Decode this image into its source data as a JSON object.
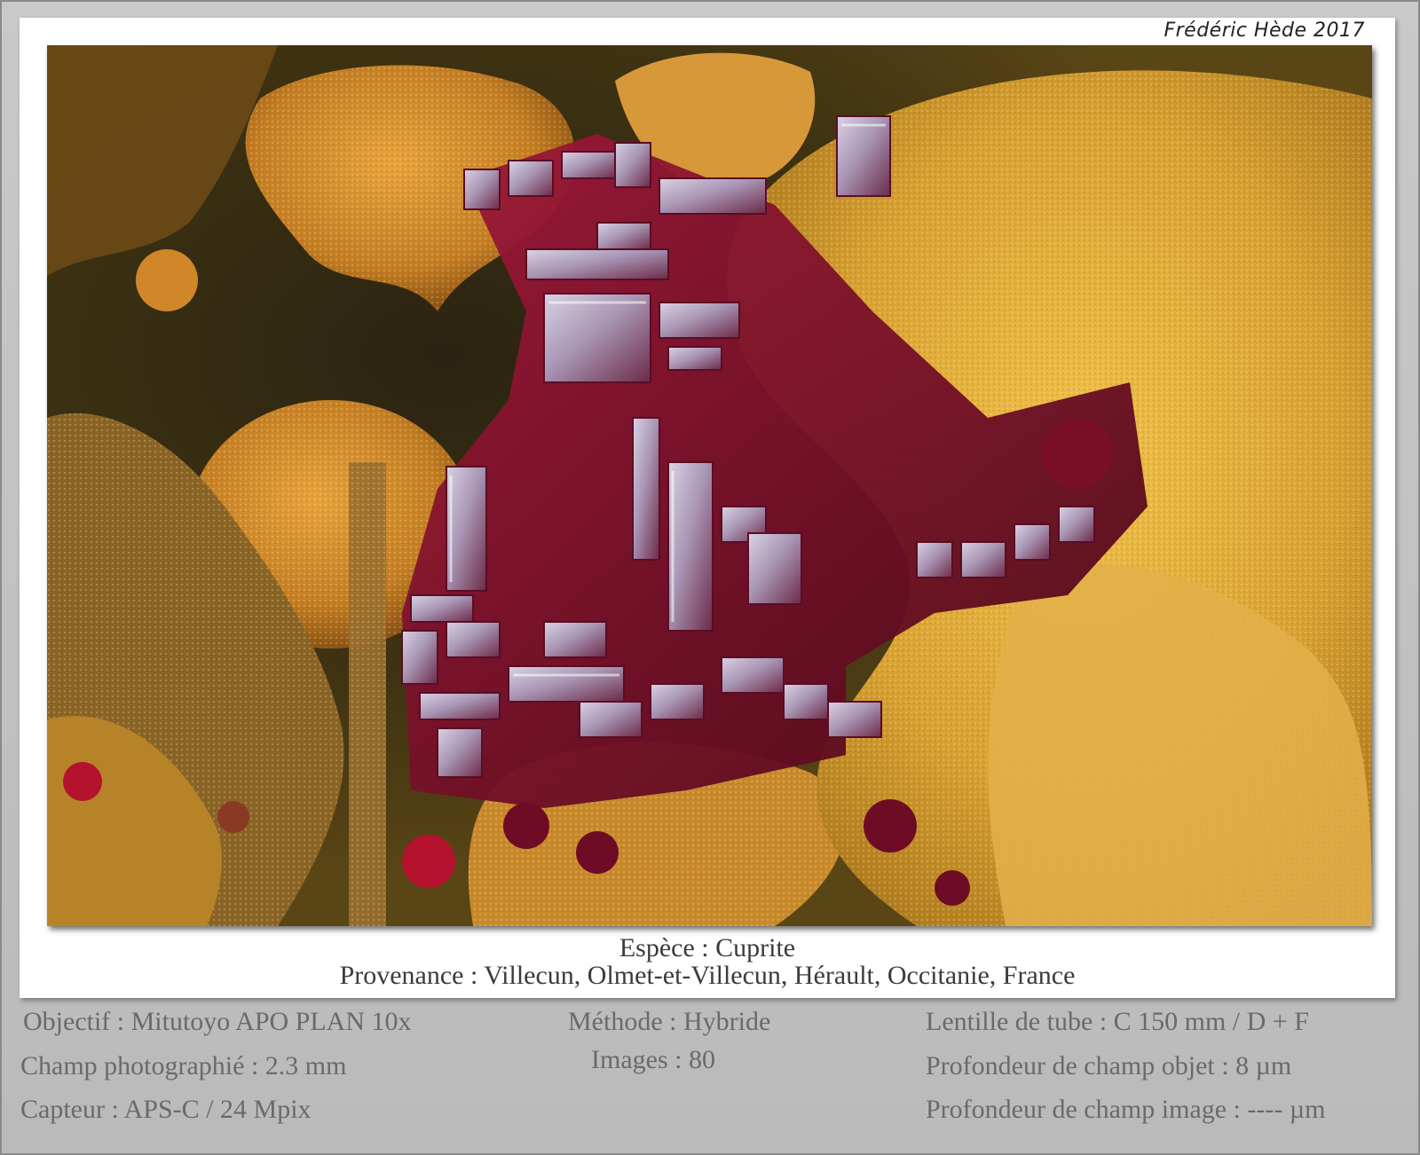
{
  "credit": "Frédéric Hède 2017",
  "caption": {
    "species": "Espèce : Cuprite",
    "provenance": "Provenance : Villecun, Olmet-et-Villecun, Hérault, Occitanie, France"
  },
  "info": {
    "objective": "Objectif : Mitutoyo APO PLAN 10x",
    "field": "Champ photographié : 2.3 mm",
    "sensor": "Capteur : APS-C / 24 Mpix",
    "method": "Méthode : Hybride",
    "images": "Images : 80",
    "tube_lens": "Lentille de tube : C 150 mm / D + F",
    "dof_object": "Profondeur de champ objet : 8 µm",
    "dof_image": "Profondeur de champ image : ---- µm"
  },
  "colors": {
    "background": "#bdbdbd",
    "card": "#ffffff",
    "crystal": "#7a0f2a",
    "matrix_orange": "#c98a2a",
    "matrix_yellow": "#d9a834"
  }
}
